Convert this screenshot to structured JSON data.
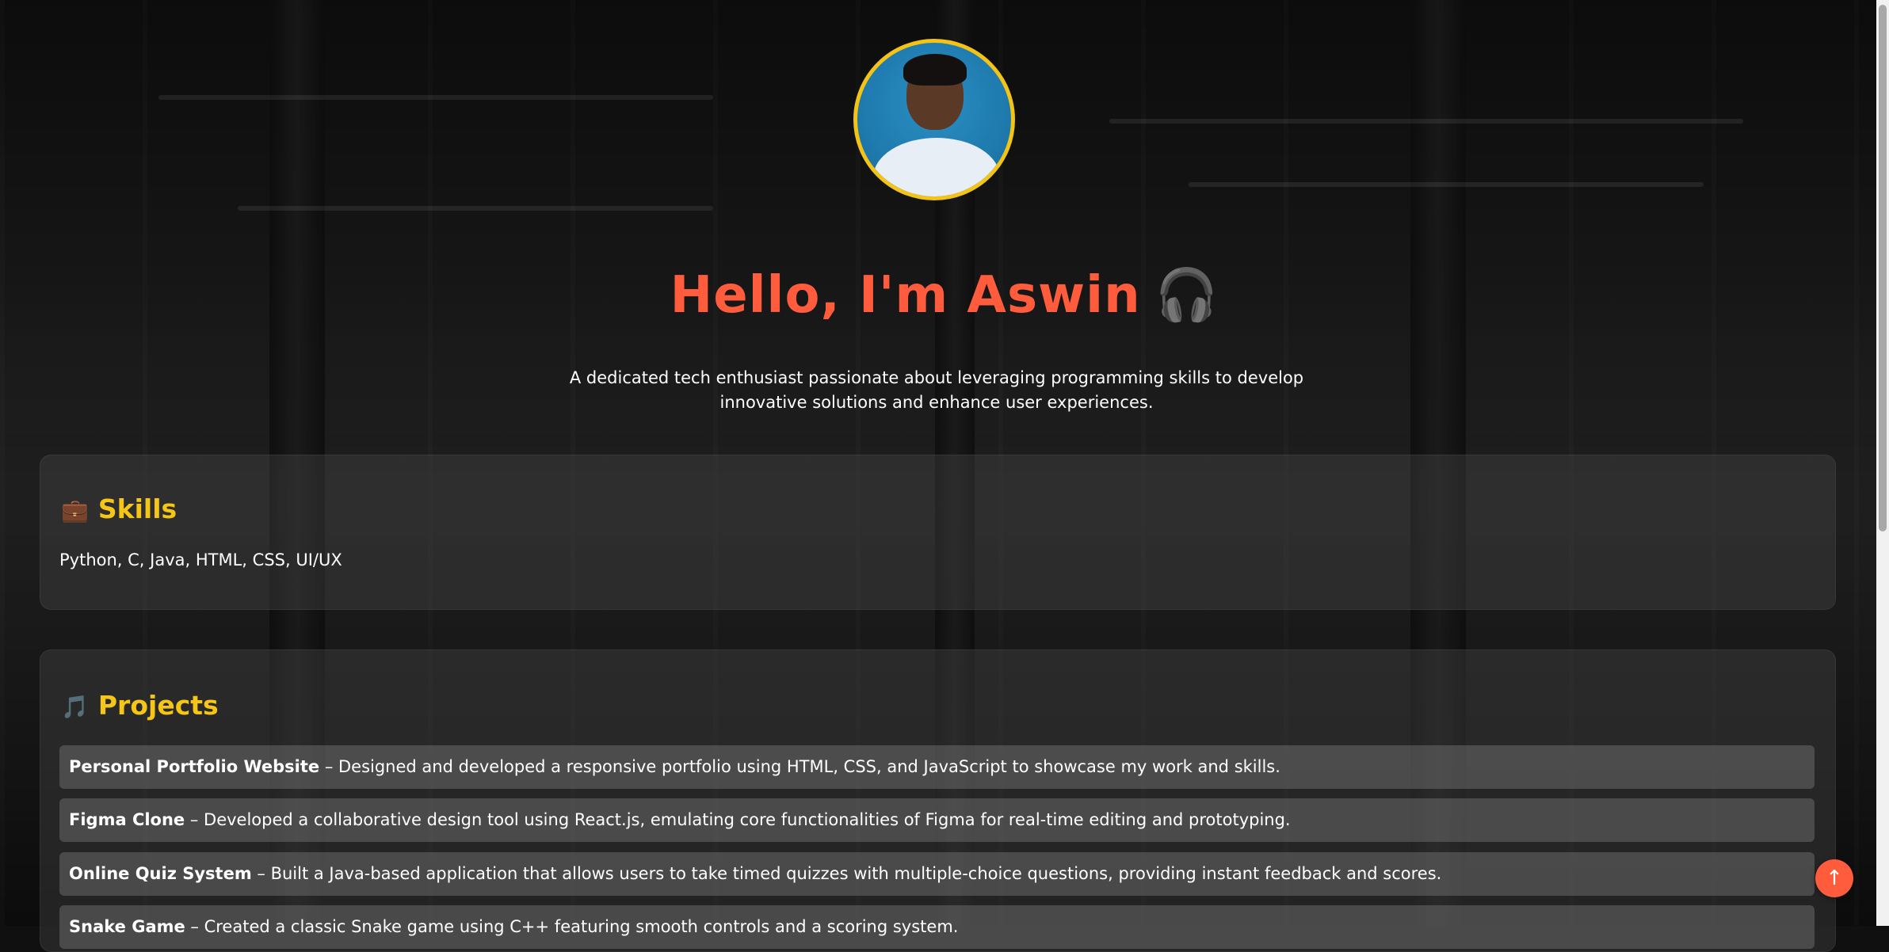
{
  "hero": {
    "greeting": "Hello, I'm Aswin",
    "greeting_emoji": "🎧",
    "tagline": "A dedicated tech enthusiast passionate about leveraging programming skills to develop innovative solutions and enhance user experiences."
  },
  "skills": {
    "icon": "💼",
    "title": "Skills",
    "list": "Python, C, Java, HTML, CSS, UI/UX"
  },
  "projects": {
    "icon": "🎵",
    "title": "Projects",
    "items": [
      {
        "name": "Personal Portfolio Website",
        "description": " – Designed and developed a responsive portfolio using HTML, CSS, and JavaScript to showcase my work and skills."
      },
      {
        "name": "Figma Clone",
        "description": " – Developed a collaborative design tool using React.js, emulating core functionalities of Figma for real-time editing and prototyping."
      },
      {
        "name": "Online Quiz System",
        "description": " – Built a Java-based application that allows users to take timed quizzes with multiple-choice questions, providing instant feedback and scores."
      },
      {
        "name": "Snake Game",
        "description": " – Created a classic Snake game using C++ featuring smooth controls and a scoring system."
      }
    ]
  },
  "back_to_top": {
    "label": "↑"
  },
  "colors": {
    "accent": "#ff5c3d",
    "heading": "#f5c518",
    "avatar_border": "#f3c316"
  }
}
